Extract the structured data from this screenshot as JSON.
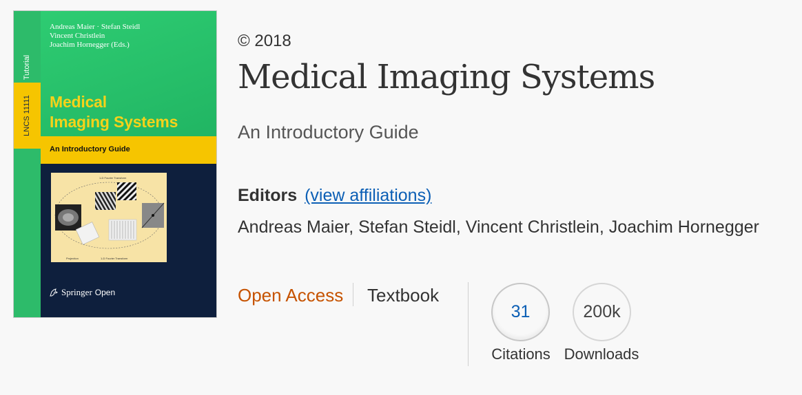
{
  "cover": {
    "editors_lines": [
      "Andreas Maier · Stefan Steidl",
      "Vincent Christlein",
      "Joachim Hornegger (Eds.)"
    ],
    "series": "Tutorial",
    "lncs": "LNCS 11111",
    "title_lines": [
      "Medical",
      "Imaging Systems"
    ],
    "subtitle": "An Introductory Guide",
    "illustration_caption_top": "1-D Fourier Transform",
    "illustration_caption_left": "Projection",
    "illustration_caption_right": "1-D Fourier Transform",
    "publisher": "Springer",
    "publisher_suffix": "Open",
    "colors": {
      "green": "#2ecc72",
      "yellow": "#f6c500",
      "navy": "#0e1f3d"
    }
  },
  "book": {
    "copyright": "© 2018",
    "title": "Medical Imaging Systems",
    "subtitle": "An Introductory Guide",
    "editors_label": "Editors",
    "affiliations_link": "(view affiliations)",
    "editors": "Andreas Maier, Stefan Steidl, Vincent Christlein, Joachim Hornegger"
  },
  "tags": {
    "open_access": "Open Access",
    "type": "Textbook"
  },
  "metrics": {
    "citations_value": "31",
    "citations_label": "Citations",
    "downloads_value": "200k",
    "downloads_label": "Downloads"
  },
  "colors": {
    "open_access": "#c65301",
    "link": "#0c5fb5"
  }
}
